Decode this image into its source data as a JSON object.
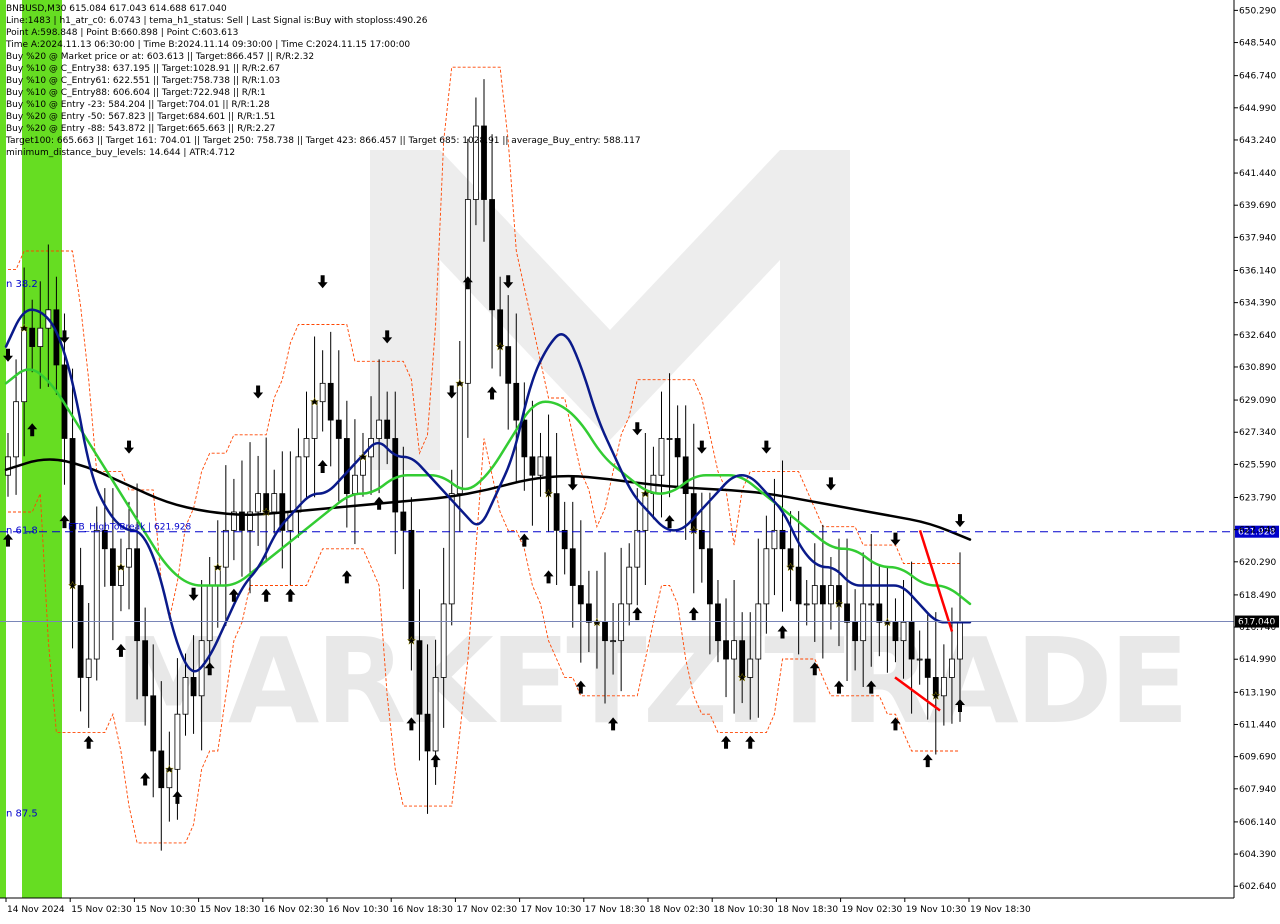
{
  "header": {
    "symbol_line": "BNBUSD,M30  615.084 617.043 614.688 617.040",
    "lines": [
      "Line:1483  |  h1_atr_c0: 6.0743  |  tema_h1_status: Sell  |  Last Signal is:Buy with stoploss:490.26",
      "Point A:598.848  |  Point B:660.898  |  Point C:603.613",
      "Time A:2024.11.13 06:30:00  |  Time B:2024.11.14 09:30:00  |  Time C:2024.11.15 17:00:00",
      "Buy %20 @ Market price or at: 603.613  ||  Target:866.457  ||  R/R:2.32",
      "Buy %10 @ C_Entry38: 637.195  ||  Target:1028.91  ||  R/R:2.67",
      "Buy %10 @ C_Entry61: 622.551  ||  Target:758.738  ||  R/R:1.03",
      "Buy %10 @ C_Entry88: 606.604  ||  Target:722.948  ||  R/R:1",
      "Buy %10 @ Entry -23: 584.204  ||  Target:704.01  ||  R/R:1.28",
      "Buy %20 @ Entry -50: 567.823  ||  Target:684.601  ||  R/R:1.51",
      "Buy %20 @ Entry -88: 543.872  ||  Target:665.663  ||  R/R:2.27",
      "Target100: 665.663  ||  Target 161: 704.01  ||  Target 250: 758.738  ||  Target 423: 866.457  ||  Target 685: 1028.91  ||  average_Buy_entry: 588.117",
      "minimum_distance_buy_levels: 14.644  |  ATR:4.712"
    ]
  },
  "chart_data": {
    "type": "candlestick",
    "symbol": "BNBUSD",
    "timeframe": "M30",
    "ohlc_last": {
      "open": 615.084,
      "high": 617.043,
      "low": 614.688,
      "close": 617.04
    },
    "ylim": [
      602.0,
      650.8
    ],
    "y_ticks": [
      "650.290",
      "648.540",
      "646.740",
      "644.990",
      "643.240",
      "641.440",
      "639.690",
      "637.940",
      "636.140",
      "634.390",
      "632.640",
      "630.890",
      "629.090",
      "627.340",
      "625.590",
      "623.790",
      "622.040",
      "620.290",
      "618.490",
      "616.740",
      "614.990",
      "613.190",
      "611.440",
      "609.690",
      "607.940",
      "606.140",
      "604.390",
      "602.640"
    ],
    "x_ticks": [
      "14 Nov 2024",
      "15 Nov 02:30",
      "15 Nov 10:30",
      "15 Nov 18:30",
      "16 Nov 02:30",
      "16 Nov 10:30",
      "16 Nov 18:30",
      "17 Nov 02:30",
      "17 Nov 10:30",
      "17 Nov 18:30",
      "18 Nov 02:30",
      "18 Nov 10:30",
      "18 Nov 18:30",
      "19 Nov 02:30",
      "19 Nov 10:30",
      "19 Nov 18:30"
    ],
    "levels": [
      {
        "name": "FTB_HighToBreak",
        "value": 621.928,
        "label": "621.928",
        "left_label": "FTB_HighToBreak | 621.928"
      },
      {
        "name": "current_price",
        "value": 617.04,
        "label": "617.040"
      }
    ],
    "fib_labels": [
      {
        "text": "n 38.2",
        "value": 635.4
      },
      {
        "text": "n 61.8",
        "value": 622.0
      },
      {
        "text": "n 87.5",
        "value": 606.6
      }
    ],
    "series": [
      {
        "name": "close",
        "values": [
          626,
          629,
          633,
          632,
          633,
          634,
          631,
          627,
          619,
          614,
          615,
          622,
          621,
          619,
          620,
          621,
          616,
          613,
          610,
          608,
          609,
          612,
          614,
          613,
          616,
          619,
          620,
          622,
          623,
          622,
          623,
          624,
          623,
          624,
          622,
          623,
          626,
          627,
          629,
          630,
          628,
          627,
          624,
          625,
          626,
          627,
          628,
          627,
          623,
          622,
          616,
          612,
          610,
          614,
          618,
          624,
          630,
          640,
          644,
          640,
          634,
          632,
          630,
          628,
          626,
          625,
          626,
          624,
          622,
          621,
          619,
          618,
          617,
          617,
          616,
          616,
          618,
          620,
          622,
          624,
          625,
          627,
          627,
          626,
          624,
          622,
          621,
          618,
          616,
          615,
          616,
          614,
          615,
          618,
          621,
          622,
          621,
          620,
          618,
          618,
          619,
          618,
          619,
          618,
          617,
          616,
          618,
          618,
          617,
          617,
          616,
          617,
          615,
          615,
          614,
          613,
          614,
          615,
          617
        ]
      },
      {
        "name": "ma_dark_blue",
        "values": [
          632,
          634,
          634,
          633,
          630,
          625,
          623,
          622,
          622,
          620,
          616,
          614,
          615,
          617,
          619,
          620,
          622,
          623,
          624,
          624,
          625,
          626,
          627,
          626,
          626,
          625,
          624,
          623,
          622,
          624,
          626,
          630,
          632,
          633,
          631,
          628,
          626,
          624,
          623,
          622,
          622,
          623,
          624,
          625,
          625,
          624,
          623,
          621,
          620,
          620,
          619,
          619,
          619,
          619,
          618,
          617,
          617,
          617
        ]
      },
      {
        "name": "ma_green",
        "values": [
          630,
          631,
          630,
          628,
          626,
          624,
          622,
          620,
          619,
          619,
          619,
          620,
          621,
          622,
          623,
          624,
          624,
          625,
          625,
          625,
          624,
          625,
          627,
          629,
          629,
          628,
          626,
          625,
          624,
          624,
          625,
          625,
          625,
          624,
          623,
          622,
          621,
          621,
          620,
          620,
          619,
          619,
          618
        ]
      },
      {
        "name": "ma_black",
        "values": [
          625.3,
          626.0,
          625.5,
          624.5,
          623.5,
          623.0,
          622.8,
          623.0,
          623.2,
          623.4,
          623.6,
          623.8,
          624.2,
          624.8,
          625.0,
          624.8,
          624.5,
          624.3,
          624.2,
          624.0,
          623.6,
          623.2,
          622.8,
          622.4,
          621.5
        ]
      }
    ],
    "signals": {
      "buy_arrows": 34,
      "sell_arrows": 16,
      "colors": {
        "buy": "#0000ff",
        "sell": "#ff0000",
        "star": "#ffff00"
      }
    },
    "watermark": "MARKETZITRADE",
    "colors": {
      "bull_candle": "#ffffff",
      "bear_candle": "#000000",
      "ma_dark_blue": "#0a1a8a",
      "ma_green": "#33cc33",
      "ma_black": "#000000",
      "band": "#ff4500",
      "green_zone": "#66dd22",
      "level_line": "#0000cc",
      "price_label_bg": "#0000cc",
      "last_price_label_bg": "#000000"
    }
  }
}
